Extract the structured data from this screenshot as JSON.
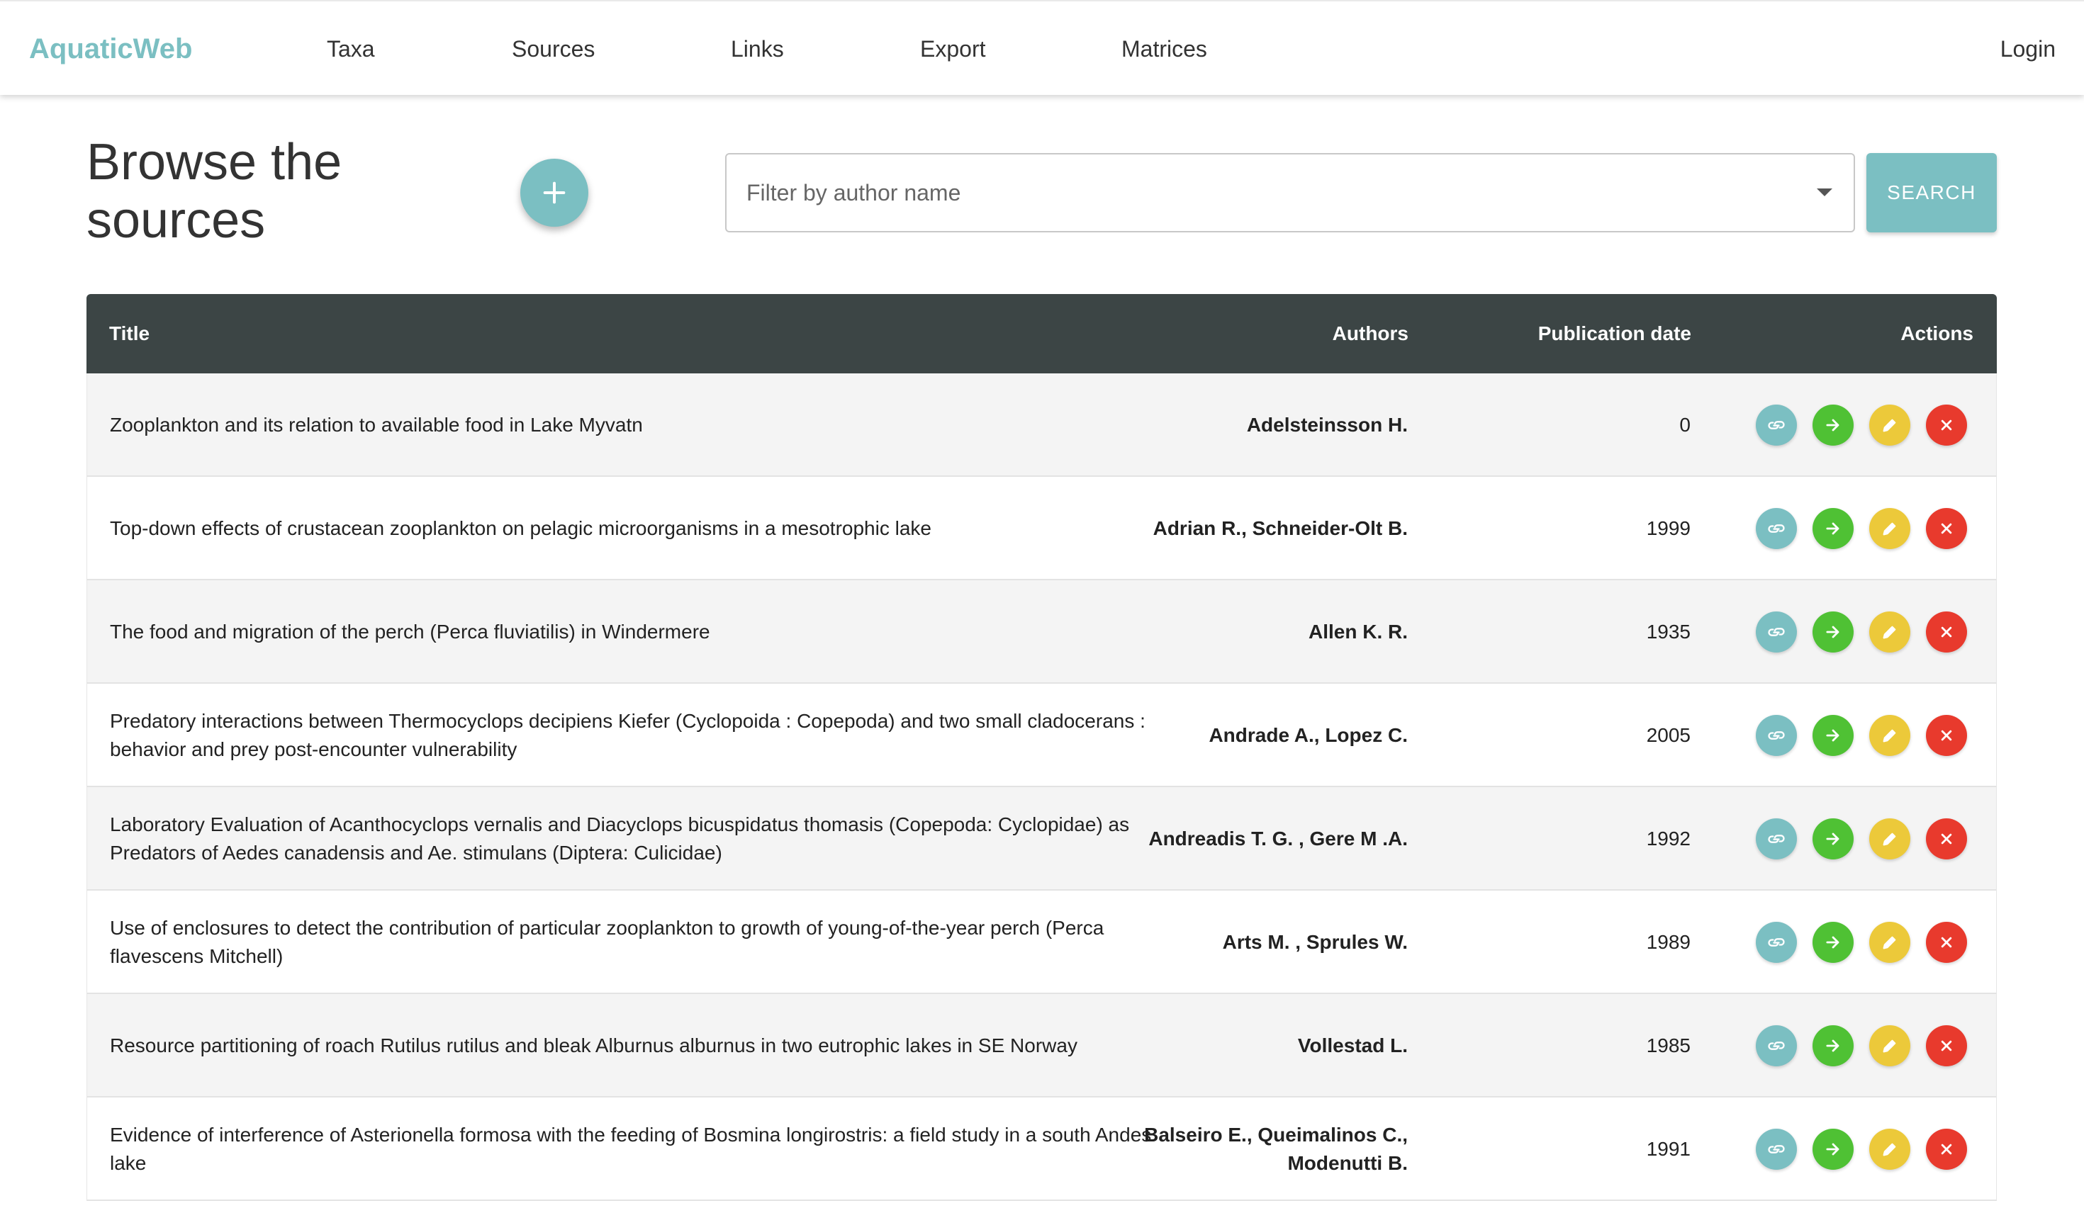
{
  "nav": {
    "brand": "AquaticWeb",
    "items": [
      "Taxa",
      "Sources",
      "Links",
      "Export",
      "Matrices"
    ],
    "login": "Login"
  },
  "page": {
    "title": "Browse the sources",
    "filter_placeholder": "Filter by author name",
    "search_label": "SEARCH"
  },
  "table": {
    "headers": {
      "title": "Title",
      "authors": "Authors",
      "date": "Publication date",
      "actions": "Actions"
    },
    "rows": [
      {
        "title": "Zooplankton and its relation to available food in Lake Myvatn",
        "authors": "Adelsteinsson H.",
        "date": "0"
      },
      {
        "title": "Top-down effects of crustacean zooplankton on pelagic microorganisms in a mesotrophic lake",
        "authors": "Adrian R., Schneider-Olt B.",
        "date": "1999"
      },
      {
        "title": "The food and migration of the perch (Perca fluviatilis) in Windermere",
        "authors": "Allen K. R.",
        "date": "1935"
      },
      {
        "title": "Predatory interactions between Thermocyclops decipiens Kiefer (Cyclopoida : Copepoda) and two small cladocerans : behavior and prey post-encounter vulnerability",
        "authors": "Andrade A., Lopez C.",
        "date": "2005"
      },
      {
        "title": "Laboratory Evaluation of Acanthocyclops vernalis and Diacyclops bicuspidatus thomasis (Copepoda: Cyclopidae) as Predators of Aedes canadensis and Ae. stimulans (Diptera: Culicidae)",
        "authors": "Andreadis T. G. , Gere M .A.",
        "date": "1992"
      },
      {
        "title": "Use of enclosures to detect the contribution of particular zooplankton to growth of young-of-the-year perch (Perca flavescens Mitchell)",
        "authors": "Arts M. , Sprules W.",
        "date": "1989"
      },
      {
        "title": "Resource partitioning of roach Rutilus rutilus and bleak Alburnus alburnus in two eutrophic lakes in SE Norway",
        "authors": "Vollestad L.",
        "date": "1985"
      },
      {
        "title": "Evidence of interference of Asterionella formosa with the feeding of Bosmina longirostris: a field study in a south Andes lake",
        "authors": "Balseiro E., Queimalinos C., Modenutti B.",
        "date": "1991"
      }
    ]
  },
  "colors": {
    "brand": "#7bbfc2",
    "header_bg": "#3c4545",
    "link_action": "#7bbfc2",
    "go_action": "#4fc134",
    "edit_action": "#ecc93a",
    "delete_action": "#e83a2d"
  },
  "icons": {
    "add": "plus-icon",
    "link": "link-icon",
    "go": "arrow-right-icon",
    "edit": "pencil-icon",
    "delete": "close-icon",
    "dropdown": "caret-down-icon"
  }
}
